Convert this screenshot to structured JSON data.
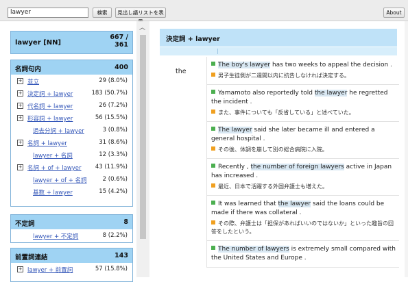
{
  "search": {
    "value": "lawyer"
  },
  "toolbar": {
    "search_label": "検索",
    "list_label": "見出し語リストを表示",
    "about_label": "About"
  },
  "lemma": {
    "title": "lawyer [NN]",
    "count": "667 /\n361"
  },
  "groups": [
    {
      "title": "名詞句内",
      "count": "400",
      "rows": [
        {
          "label": "並立",
          "count": "29 (8.0%)",
          "expandable": true
        },
        {
          "label": "決定詞 + lawyer",
          "count": "183 (50.7%)",
          "expandable": true
        },
        {
          "label": "代名詞 + lawyer",
          "count": "26 (7.2%)",
          "expandable": true
        },
        {
          "label": "形容詞 + lawyer",
          "count": "56 (15.5%)",
          "expandable": true
        },
        {
          "label": "過去分詞 + lawyer",
          "count": "3 (0.8%)",
          "expandable": false
        },
        {
          "label": "名詞 + lawyer",
          "count": "31 (8.6%)",
          "expandable": true
        },
        {
          "label": "lawyer + 名詞",
          "count": "12 (3.3%)",
          "expandable": false
        },
        {
          "label": "名詞 + of + lawyer",
          "count": "43 (11.9%)",
          "expandable": true
        },
        {
          "label": "lawyer + of + 名詞",
          "count": "2 (0.6%)",
          "expandable": false
        },
        {
          "label": "基数 + lawyer",
          "count": "15 (4.2%)",
          "expandable": false
        }
      ]
    },
    {
      "title": "不定詞",
      "count": "8",
      "rows": [
        {
          "label": "lawyer + 不定詞",
          "count": "8 (2.2%)",
          "expandable": false
        }
      ]
    },
    {
      "title": "前置詞連結",
      "count": "143",
      "rows": [
        {
          "label": "lawyer + 前置詞",
          "count": "57 (15.8%)",
          "expandable": true
        }
      ]
    }
  ],
  "detail": {
    "pattern_title": "決定詞 + lawyer",
    "head_word": "the",
    "examples": [
      {
        "en": [
          "",
          "The boy's lawyer",
          " has two weeks to appeal the decision ."
        ],
        "ja": "男子生徒側が二週間以内に抗告しなければ決定する。"
      },
      {
        "en": [
          "Yamamoto also reportedly told ",
          "the lawyer",
          " he regretted the incident ."
        ],
        "ja": "また、事件についても「反省している」と述べていた。"
      },
      {
        "en": [
          "",
          "The lawyer",
          " said she later became ill and entered a general hospital ."
        ],
        "ja": "その後、体調を崩して別の総合病院に入院。"
      },
      {
        "en": [
          "Recently , ",
          "the number of foreign lawyers",
          " active in Japan has increased ."
        ],
        "ja": "最近、日本で活躍する外国弁護士も増えた。"
      },
      {
        "en": [
          "It was learned that ",
          "the lawyer",
          " said the loans could be made if there was collateral ."
        ],
        "ja": "その際、弁護士は「担保があればいいのではないか」といった趣旨の回答をしたという。"
      },
      {
        "en": [
          "",
          "The number of lawyers",
          " is extremely small compared with the United States and Europe ."
        ],
        "ja": ""
      }
    ]
  }
}
